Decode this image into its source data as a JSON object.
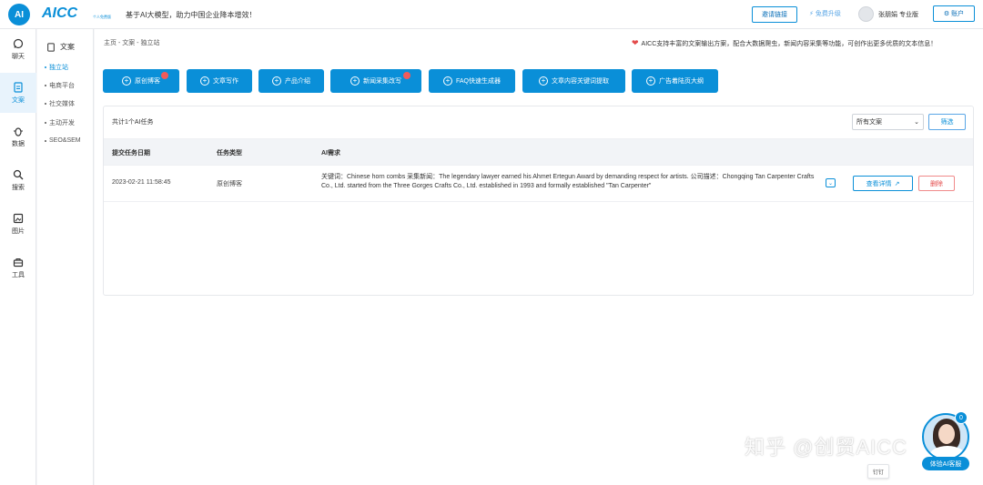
{
  "header": {
    "logo_mark": "AI",
    "logo_text": "AICC",
    "logo_sub": "个人免费版",
    "slogan": "基于AI大模型，助力中国企业降本增效！",
    "invite_label": "邀请链接",
    "upgrade_label": "免费升级",
    "user_label": "张朋娟 专业版",
    "account_label": "账户"
  },
  "leftnav": {
    "items": [
      {
        "label": "聊天",
        "icon": "whatsapp-icon"
      },
      {
        "label": "文案",
        "icon": "document-icon"
      },
      {
        "label": "数据",
        "icon": "bug-icon"
      },
      {
        "label": "搜索",
        "icon": "search-icon"
      },
      {
        "label": "图片",
        "icon": "image-icon"
      },
      {
        "label": "工具",
        "icon": "toolbox-icon"
      }
    ]
  },
  "subnav": {
    "title": "文案",
    "items": [
      "独立站",
      "电商平台",
      "社交媒体",
      "主动开发",
      "SEO&SEM"
    ]
  },
  "main": {
    "breadcrumb": "主页 - 文案 - 独立站",
    "notice": "AICC支持丰富的文案输出方案，配合大数据爬虫，新闻内容采集等功能，可创作出更多优质的文本信息！",
    "toolbar": [
      {
        "label": "原创博客",
        "hot": true
      },
      {
        "label": "文章写作",
        "hot": false
      },
      {
        "label": "产品介绍",
        "hot": false
      },
      {
        "label": "新闻采集改写",
        "hot": true
      },
      {
        "label": "FAQ快速生成器",
        "hot": false
      },
      {
        "label": "文章内容关键词提取",
        "hot": false
      },
      {
        "label": "广告着陆页大纲",
        "hot": false
      }
    ],
    "task_count": "共计1个AI任务",
    "filter_select": "所有文案",
    "filter_button": "筛选",
    "table": {
      "headers": [
        "提交任务日期",
        "任务类型",
        "AI需求"
      ],
      "rows": [
        {
          "date": "2023-02-21 11:58:45",
          "type": "原创博客",
          "requirement": "关键词：Chinese horn combs 采集新闻：The legendary lawyer earned his Ahmet Ertegun Award by demanding respect for artists. 公司描述：Chongqing Tan Carpenter Crafts Co., Ltd. started from the Three Gorges Crafts Co., Ltd. established in 1993 and formally established \"Tan Carpenter\"",
          "detail_label": "查看详情",
          "delete_label": "删除"
        }
      ]
    }
  },
  "widgets": {
    "watermark": "知乎 @创贸AICC",
    "pin_label": "钉钉",
    "support_badge": "0",
    "support_label": "体验AI客服"
  },
  "colors": {
    "primary": "#0a8fd8",
    "danger": "#e34a4a"
  }
}
